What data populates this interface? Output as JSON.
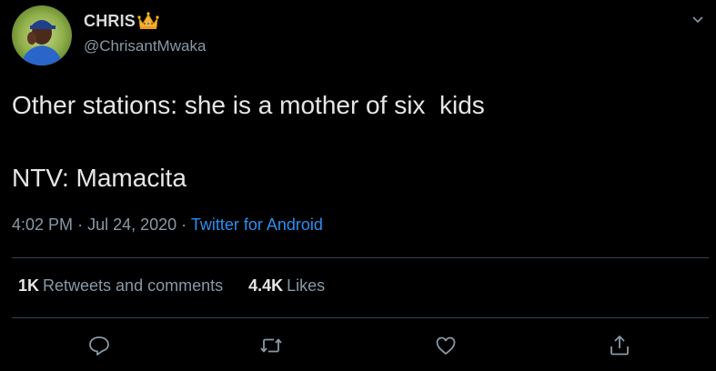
{
  "user": {
    "display_name": "CHRIS",
    "handle": "@ChrisantMwaka",
    "avatar_icon": "profile-photo",
    "badge_icon": "crown-emoji"
  },
  "tweet": {
    "line1": "Other stations: she is a mother of six  kids",
    "line2": "NTV: Mamacita"
  },
  "meta": {
    "time": "4:02 PM",
    "separator": "·",
    "date": "Jul 24, 2020",
    "source": "Twitter for Android"
  },
  "stats": {
    "retweets_count": "1K",
    "retweets_label": "Retweets and comments",
    "likes_count": "4.4K",
    "likes_label": "Likes"
  },
  "actions": {
    "reply_icon": "reply-icon",
    "retweet_icon": "retweet-icon",
    "like_icon": "like-icon",
    "share_icon": "share-icon"
  },
  "colors": {
    "background": "#000000",
    "text": "#d9d9d9",
    "muted": "#8899a6",
    "link": "#2b8ef0",
    "divider": "#38444d",
    "crown": "#f5b731"
  }
}
